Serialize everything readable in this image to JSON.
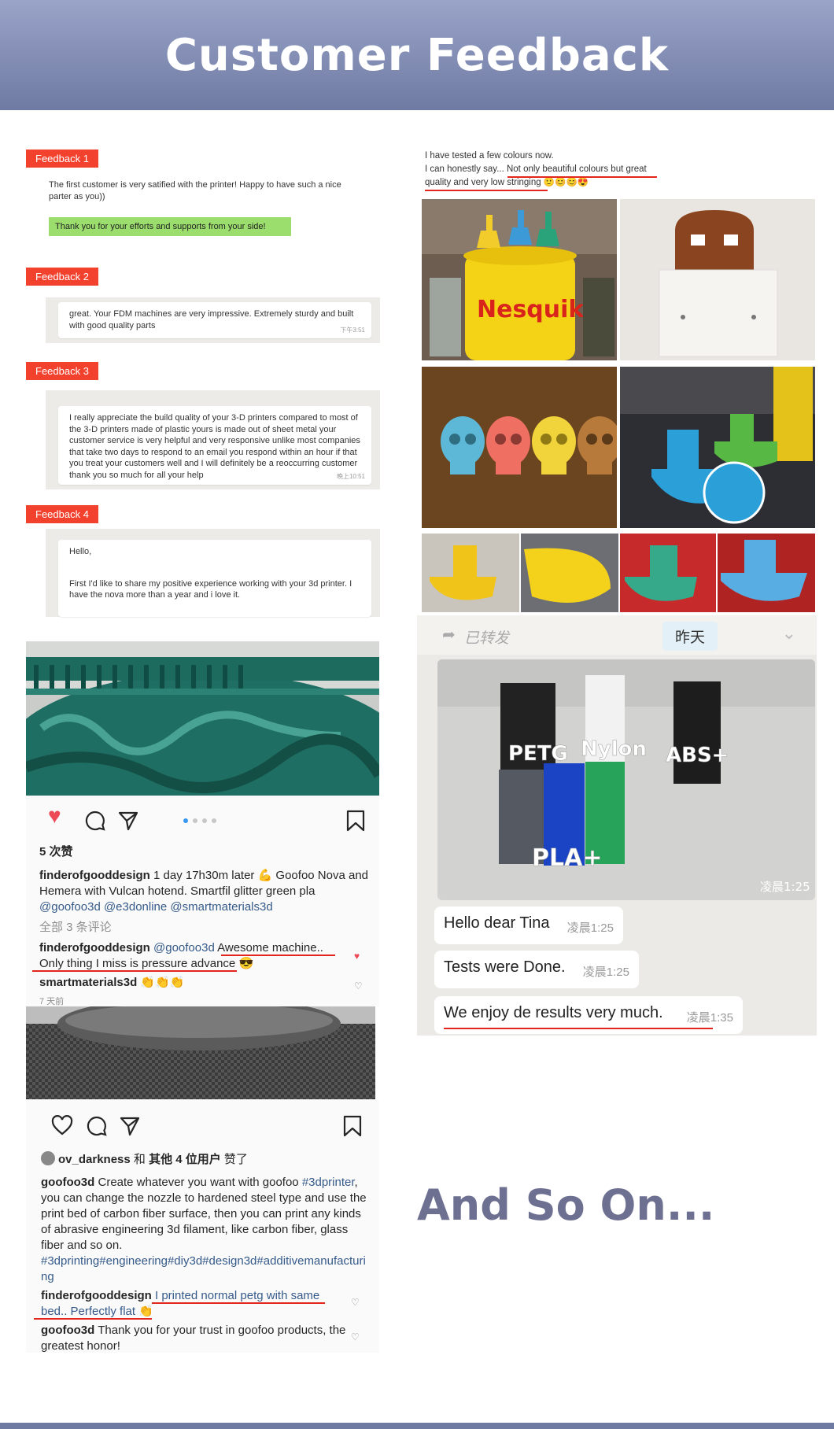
{
  "header": {
    "title": "Customer Feedback"
  },
  "feedback": [
    {
      "tag": "Feedback 1",
      "text": "The first customer is very satified with the printer! Happy to have such a nice parter as you))",
      "reply": "Thank you for your efforts and supports from your side!"
    },
    {
      "tag": "Feedback 2",
      "text": "great. Your FDM machines are very impressive. Extremely sturdy and built with good quality parts",
      "time": "下午3:51"
    },
    {
      "tag": "Feedback 3",
      "text": "I really appreciate the build quality of your 3-D printers compared to most of the 3-D printers made of plastic yours is made out of sheet metal your customer service is very helpful and very responsive unlike most companies that take two days to respond to an email you respond within an hour if that you treat your customers well and I will definitely be a reoccurring customer thank you so much for all your help",
      "time": "晚上10:51"
    },
    {
      "tag": "Feedback 4",
      "greeting": "Hello,",
      "text": "First I'd like to share my positive experience working with your 3d printer. I have the nova more than a year and i love it."
    }
  ],
  "insta1": {
    "likes": "5 次赞",
    "post_user": "finderofgooddesign",
    "post_text": " 1 day 17h30m later 💪 Goofoo Nova and Hemera with Vulcan hotend. Smartfil glitter green pla",
    "post_tags": "@goofoo3d @e3donline @smartmaterials3d",
    "all_comments": "全部 3 条评论",
    "c1_user": "finderofgooddesign",
    "c1_mention": " @goofoo3d",
    "c1_text": " Awesome machine.. Only thing I miss is pressure advance 😎",
    "c2_user": "smartmaterials3d",
    "c2_text": " 👏👏👏",
    "cut": "7 天前"
  },
  "insta2": {
    "liked_user": "ov_darkness",
    "liked_mid": " 和 ",
    "liked_others": "其他 4 位用户",
    "liked_end": " 赞了",
    "post_user": "goofoo3d",
    "post_text": " Create whatever you want with goofoo ",
    "post_tag1": "#3dprinter",
    "post_text2": ", you can change the nozzle to hardened steel type and use the print bed of carbon fiber surface, then you can print any kinds of abrasive engineering 3d filament, like carbon fiber, glass fiber and so on.",
    "post_tags2": "#3dprinting#engineering#diy3d#design3d#additivemanufacturing",
    "c1_user": "finderofgooddesign",
    "c1_text": " I printed normal petg with same bed.. Perfectly flat 👏",
    "c2_user": "goofoo3d",
    "c2_text": " Thank you for your trust in goofoo products, the greatest honor!"
  },
  "review_text": {
    "line1": "I have tested a few colours now.",
    "line2": "I can honestly say... Not only beautiful colours but great quality and very low stringing 🙂😊😊😍"
  },
  "wechat": {
    "forwarded": "已转发",
    "yesterday": "昨天",
    "photo_labels": [
      "PETG",
      "Nylon",
      "ABS+",
      "PLA+"
    ],
    "photo_time": "凌晨1:25",
    "messages": [
      {
        "text": "Hello dear Tina",
        "time": "凌晨1:25"
      },
      {
        "text": "Tests were Done.",
        "time": "凌晨1:25"
      },
      {
        "text": "We enjoy de results very much.",
        "time": "凌晨1:35"
      }
    ]
  },
  "footer": {
    "and_so_on": "And So On..."
  },
  "colors": {
    "header": "#7b86b0",
    "tag": "#f2412d",
    "underline": "#e3261c",
    "accent_text": "#6d7091"
  }
}
